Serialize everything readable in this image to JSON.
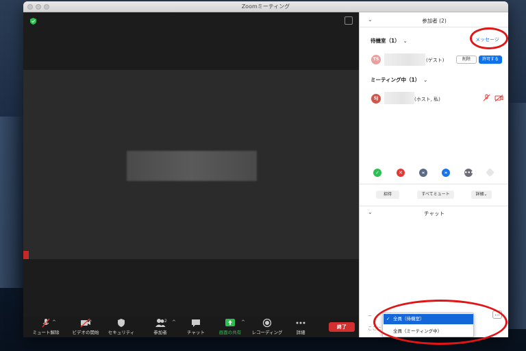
{
  "window": {
    "title": "Zoomミーティング"
  },
  "toolbar": {
    "unmute_label": "ミュート解除",
    "video_label": "ビデオの開始",
    "security_label": "セキュリティ",
    "participants_label": "参加者",
    "participants_count": "2",
    "chat_label": "チャット",
    "share_label": "画面の共有",
    "recording_label": "レコーディング",
    "more_label": "詳細",
    "end_label": "終了"
  },
  "participants_panel": {
    "title": "参加者 (2)",
    "waiting_room": {
      "title": "待機室（1）",
      "message_label": "メッセージ",
      "people": [
        {
          "initials": "TS",
          "role": "(ゲスト)",
          "remove_label": "削除",
          "admit_label": "許可する"
        }
      ]
    },
    "in_meeting": {
      "title": "ミーティング中（1）",
      "people": [
        {
          "initials": "SJ",
          "role": "(ホスト, 私)"
        }
      ]
    },
    "buttons": {
      "invite_label": "招待",
      "mute_all_label": "すべてミュート",
      "more_label": "詳細"
    }
  },
  "chat_panel": {
    "title": "チャット",
    "input_hint": "ここに",
    "more_label": "...",
    "recipient_options": [
      {
        "label": "全員（待機室）",
        "selected": true
      },
      {
        "label": "全員（ミーティング中）",
        "selected": false
      }
    ]
  },
  "colors": {
    "accent_blue": "#0e72ed",
    "end_red": "#d32f2f",
    "share_green": "#2dbf51",
    "annotation_red": "#e01616"
  }
}
